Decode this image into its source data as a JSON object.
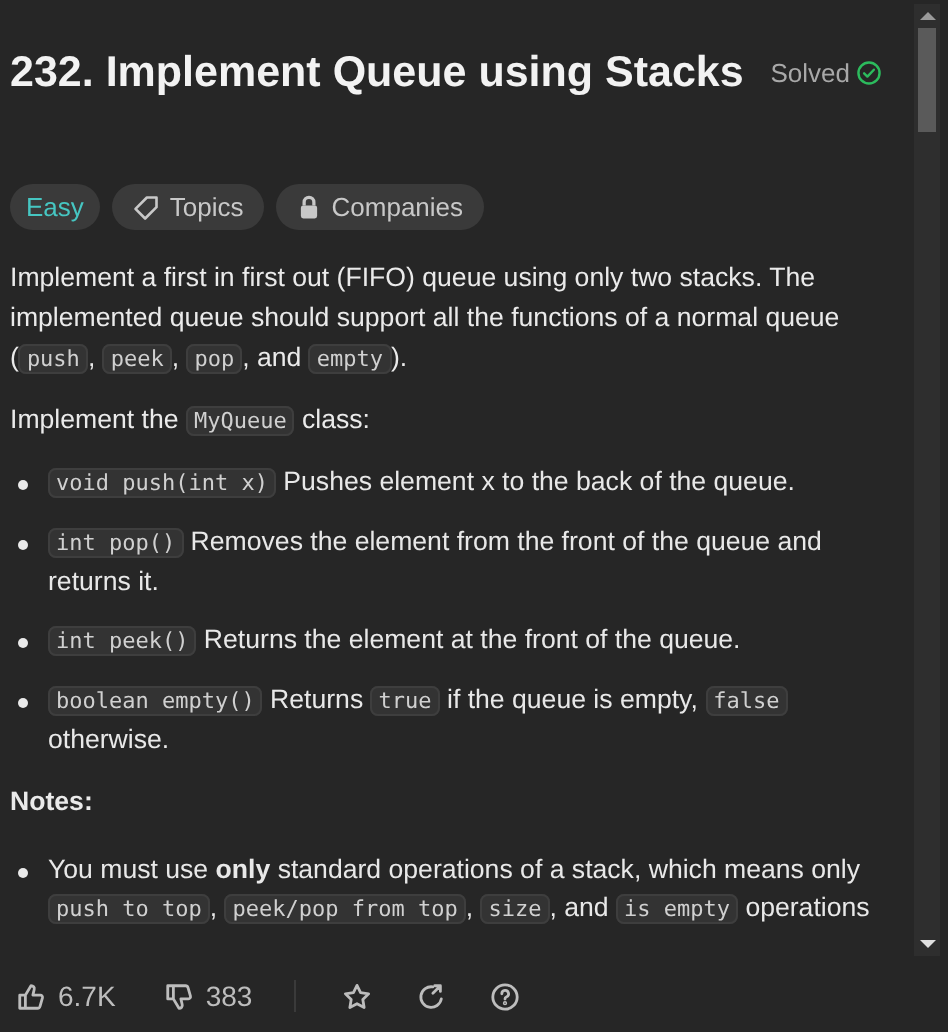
{
  "title": "232. Implement Queue using Stacks",
  "status": {
    "label": "Solved",
    "solved": true
  },
  "tags": [
    {
      "kind": "difficulty",
      "label": "Easy"
    },
    {
      "kind": "topics",
      "label": "Topics"
    },
    {
      "kind": "companies",
      "label": "Companies"
    }
  ],
  "description": [
    {
      "kind": "paragraph",
      "parts": [
        {
          "kind": "text",
          "text": "Implement a first in first out (FIFO) queue using only two stacks. The implemented queue should support all the functions of a normal queue ("
        },
        {
          "kind": "code",
          "text": "push"
        },
        {
          "kind": "text",
          "text": ", "
        },
        {
          "kind": "code",
          "text": "peek"
        },
        {
          "kind": "text",
          "text": ", "
        },
        {
          "kind": "code",
          "text": "pop"
        },
        {
          "kind": "text",
          "text": ", and "
        },
        {
          "kind": "code",
          "text": "empty"
        },
        {
          "kind": "text",
          "text": ")."
        }
      ]
    },
    {
      "kind": "paragraph",
      "parts": [
        {
          "kind": "text",
          "text": "Implement the "
        },
        {
          "kind": "code",
          "text": "MyQueue"
        },
        {
          "kind": "text",
          "text": " class:"
        }
      ]
    },
    {
      "kind": "bullet",
      "parts": [
        {
          "kind": "code",
          "text": "void push(int x)"
        },
        {
          "kind": "text",
          "text": " Pushes element x to the back of the queue."
        }
      ]
    },
    {
      "kind": "bullet",
      "parts": [
        {
          "kind": "code",
          "text": "int pop()"
        },
        {
          "kind": "text",
          "text": " Removes the element from the front of the queue and returns it."
        }
      ]
    },
    {
      "kind": "bullet",
      "parts": [
        {
          "kind": "code",
          "text": "int peek()"
        },
        {
          "kind": "text",
          "text": " Returns the element at the front of the queue."
        }
      ]
    },
    {
      "kind": "bullet",
      "parts": [
        {
          "kind": "code",
          "text": "boolean empty()"
        },
        {
          "kind": "text",
          "text": " Returns "
        },
        {
          "kind": "code",
          "text": "true"
        },
        {
          "kind": "text",
          "text": " if the queue is empty, "
        },
        {
          "kind": "code",
          "text": "false"
        },
        {
          "kind": "text",
          "text": " otherwise."
        }
      ]
    },
    {
      "kind": "heading",
      "parts": [
        {
          "kind": "text",
          "text": "Notes:"
        }
      ]
    },
    {
      "kind": "bullet",
      "parts": [
        {
          "kind": "text",
          "text": "You must use **only** standard operations of a stack, which means only "
        },
        {
          "kind": "code",
          "text": "push to top"
        },
        {
          "kind": "text",
          "text": ", "
        },
        {
          "kind": "code",
          "text": "peek/pop from top"
        },
        {
          "kind": "text",
          "text": ", "
        },
        {
          "kind": "code",
          "text": "size"
        },
        {
          "kind": "text",
          "text": ", and "
        },
        {
          "kind": "code",
          "text": "is empty"
        },
        {
          "kind": "text",
          "text": " operations"
        }
      ]
    }
  ],
  "footer": [
    {
      "kind": "like",
      "label": "6.7K"
    },
    {
      "kind": "dislike",
      "label": "383"
    },
    {
      "kind": "divider"
    },
    {
      "kind": "star"
    },
    {
      "kind": "share"
    },
    {
      "kind": "help"
    }
  ]
}
